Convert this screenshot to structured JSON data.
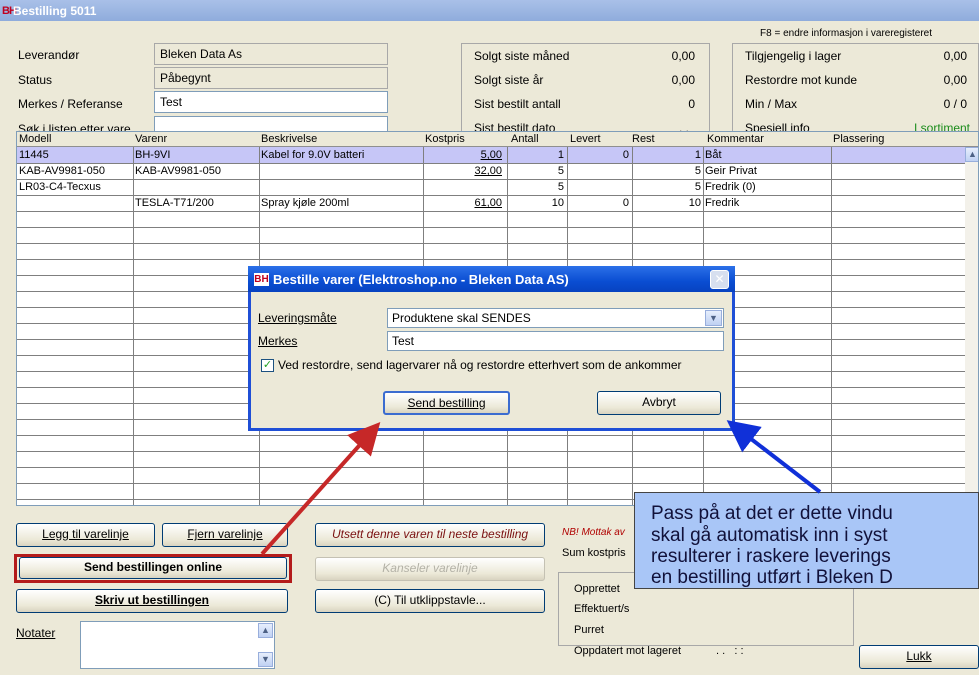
{
  "window": {
    "logo": "BH",
    "title": "Bestilling 5011"
  },
  "f8_hint": "F8 = endre informasjon i vareregisteret",
  "form": {
    "leverandor_label": "Leverandør",
    "leverandor_value": "Bleken Data As",
    "status_label": "Status",
    "status_value": "Påbegynt",
    "merkes_label": "Merkes / Referanse",
    "merkes_value": "Test",
    "sok_label": "Søk i listen etter vare",
    "sok_value": ""
  },
  "stats": {
    "solgt_mnd_label": "Solgt siste måned",
    "solgt_mnd_value": "0,00",
    "solgt_ar_label": "Solgt siste år",
    "solgt_ar_value": "0,00",
    "sist_antall_label": "Sist bestilt antall",
    "sist_antall_value": "0",
    "sist_dato_label": "Sist bestilt dato",
    "sist_dato_value": ". ."
  },
  "stock": {
    "tilgjengelig_label": "Tilgjengelig i lager",
    "tilgjengelig_value": "0,00",
    "restordre_label": "Restordre mot kunde",
    "restordre_value": "0,00",
    "minmax_label": "Min / Max",
    "minmax_value": "0 / 0",
    "spesiell_label": "Spesiell info",
    "spesiell_value": "I sortiment",
    "spesiell_color": "#1a8c1a"
  },
  "table": {
    "columns": [
      "Modell",
      "Varenr",
      "Beskrivelse",
      "Kostpris",
      "Antall",
      "Levert",
      "Rest",
      "Kommentar",
      "Plassering"
    ],
    "rows": [
      {
        "modell": "11445",
        "varenr": "BH-9VI",
        "beskrivelse": "Kabel for 9.0V batteri",
        "kostpris": "5,00",
        "antall": "1",
        "levert": "0",
        "rest": "1",
        "kommentar": "Båt",
        "plassering": ""
      },
      {
        "modell": "KAB-AV9981-050",
        "varenr": "KAB-AV9981-050",
        "beskrivelse": "",
        "kostpris": "32,00",
        "antall": "5",
        "levert": "",
        "rest": "5",
        "kommentar": "Geir Privat",
        "plassering": ""
      },
      {
        "modell": "LR03-C4-Tecxus",
        "varenr": "",
        "beskrivelse": "",
        "kostpris": "",
        "antall": "5",
        "levert": "",
        "rest": "5",
        "kommentar": "Fredrik (0)",
        "plassering": ""
      },
      {
        "modell": "",
        "varenr": "TESLA-T71/200",
        "beskrivelse": "Spray kjøle 200ml",
        "kostpris": "61,00",
        "antall": "10",
        "levert": "0",
        "rest": "10",
        "kommentar": "Fredrik",
        "plassering": ""
      }
    ]
  },
  "buttons": {
    "legg_til": "Legg til varelinje",
    "fjern": "Fjern varelinje",
    "utsett": "Utsett denne varen til neste bestilling",
    "send_online": "Send bestillingen online",
    "kanseler": "Kanseler varelinje",
    "skriv_ut": "Skriv ut bestillingen",
    "utklipp": "(C) Til utklippstavle...",
    "lukk": "Lukk"
  },
  "bottom": {
    "nb_text": "NB! Mottak av",
    "sum_label": "Sum kostpris",
    "notater_label": "Notater",
    "opprettet_label": "Opprettet",
    "effektuert_label": "Effektuert/s",
    "purret_label": "Purret",
    "oppdatert_label": "Oppdatert mot lageret",
    "oppdatert_value": ". .   : :"
  },
  "dialog": {
    "logo": "BH",
    "title": "Bestille varer (Elektroshop.no - Bleken Data AS)",
    "leveringsmate_label": "Leveringsmåte",
    "leveringsmate_value": "Produktene skal SENDES",
    "merkes_label": "Merkes",
    "merkes_value": "Test",
    "checkbox_label": "Ved restordre, send lagervarer nå og restordre etterhvert som de ankommer",
    "send_button": "Send bestilling",
    "avbryt_button": "Avbryt",
    "close_glyph": "✕"
  },
  "note": {
    "lines": [
      "Pass på at det er dette vindu",
      "skal gå automatisk inn i syst",
      "resulterer i raskere leverings",
      "en bestilling utført i Bleken D"
    ]
  },
  "colors": {
    "highlight_red": "#b31b1b",
    "arrow_red": "#c62828",
    "arrow_blue": "#1030d8"
  }
}
